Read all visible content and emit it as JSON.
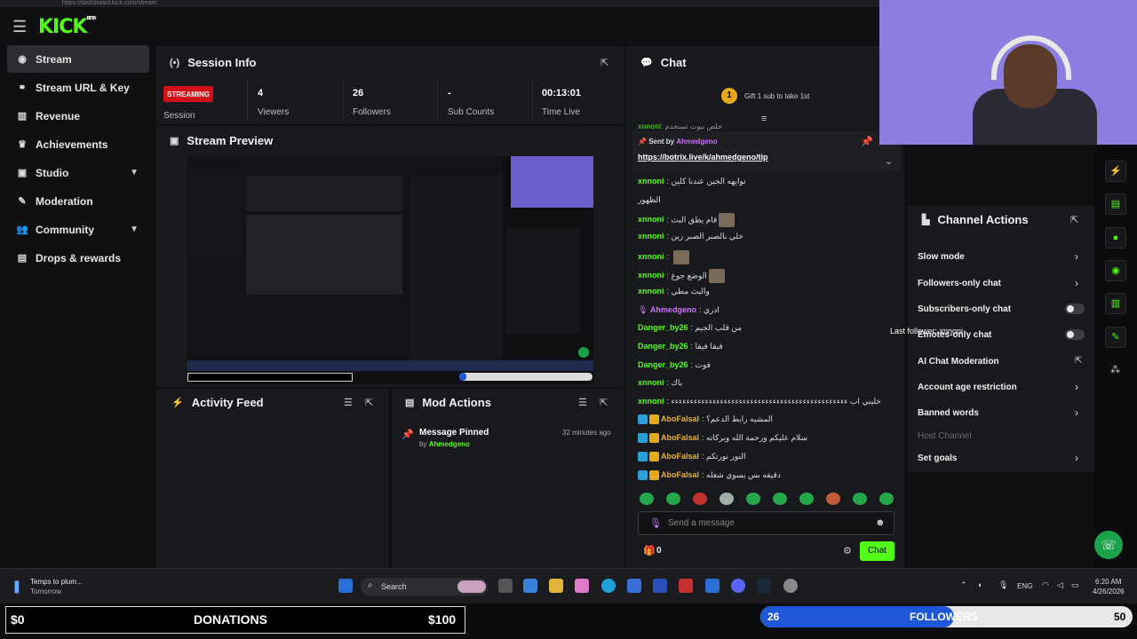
{
  "browser": {
    "url": "https://dashboard.kick.com/stream"
  },
  "app": {
    "logo": "KICK",
    "logo_sup": "BETA",
    "accent": "#53fc18"
  },
  "sidebar": {
    "items": [
      {
        "label": "Stream",
        "icon": "broadcast-icon"
      },
      {
        "label": "Stream URL & Key",
        "icon": "link-icon"
      },
      {
        "label": "Revenue",
        "icon": "chart-icon"
      },
      {
        "label": "Achievements",
        "icon": "trophy-icon"
      },
      {
        "label": "Studio",
        "icon": "tv-icon"
      },
      {
        "label": "Moderation",
        "icon": "wrench-icon"
      },
      {
        "label": "Community",
        "icon": "users-icon"
      },
      {
        "label": "Drops & rewards",
        "icon": "gift-icon"
      }
    ]
  },
  "session": {
    "title": "Session Info",
    "status": "STREAMING",
    "status_label": "Session",
    "stats": [
      {
        "value": "4",
        "label": "Viewers"
      },
      {
        "value": "26",
        "label": "Followers"
      },
      {
        "value": "-",
        "label": "Sub Counts"
      },
      {
        "value": "00:13:01",
        "label": "Time Live"
      }
    ]
  },
  "preview": {
    "title": "Stream Preview"
  },
  "activity": {
    "title": "Activity Feed"
  },
  "mod_actions": {
    "title": "Mod Actions",
    "item_title": "Message Pinned",
    "item_by": "by",
    "item_user": "Ahmedgeno",
    "item_time": "32 minutes ago"
  },
  "chat": {
    "title": "Chat",
    "gift_number": "1",
    "gift_text": "Gift 1 sub to take 1st",
    "pinned_sent_by": "Sent by",
    "pinned_user": "Ahmedgeno",
    "pinned_link": "https://botrix.live/k/ahmedgeno/tip",
    "partial_top": "خلص ببوت تستخدم",
    "messages": [
      {
        "user": "xnnoni",
        "text": "نوايهه الجين عندنا كلين",
        "color": "g"
      },
      {
        "user": "",
        "text": "الظهور",
        "color": "g"
      },
      {
        "user": "xnnoni",
        "text": "قام يطق البث",
        "color": "g"
      },
      {
        "user": "xnnoni",
        "text": "خلي بالصبر الصبر زين",
        "color": "g"
      },
      {
        "user": "xnnoni",
        "text": "",
        "color": "g"
      },
      {
        "user": "xnnoni",
        "text": "الوضع جوع",
        "color": "g"
      },
      {
        "user": "xnnoni",
        "text": "والبث مطي",
        "color": "g"
      },
      {
        "user": "Ahmedgeno",
        "text": "ادري",
        "color": "p"
      },
      {
        "user": "Danger_by26",
        "text": "من قلب الجيم",
        "color": "g"
      },
      {
        "user": "Danger_by26",
        "text": "فيقا فيقا",
        "color": "g"
      },
      {
        "user": "Danger_by26",
        "text": "فوت",
        "color": "g"
      },
      {
        "user": "xnnoni",
        "text": "باك",
        "color": "g"
      },
      {
        "user": "xnnoni",
        "text": "خليني اب ءءءءءءءءءءءءءءءءءءءءءءءءءءءءءءءءءءءءءءءءءءءءءءء",
        "color": "g"
      },
      {
        "user": "AboFalsal",
        "text": "المشيه رابط الدعم؟",
        "color": "y"
      },
      {
        "user": "AboFalsal",
        "text": "سلام عليكم ورحمة الله وبركاته",
        "color": "y"
      },
      {
        "user": "AboFalsal",
        "text": "النور نورتكم",
        "color": "y"
      },
      {
        "user": "AboFalsal",
        "text": "دقيقه بس بسوي شغله",
        "color": "y"
      }
    ],
    "input_placeholder": "Send a message",
    "points": "0",
    "send_label": "Chat"
  },
  "channel_actions": {
    "title": "Channel Actions",
    "items": [
      {
        "label": "Slow mode",
        "control": "chevron"
      },
      {
        "label": "Followers-only chat",
        "control": "chevron"
      },
      {
        "label": "Subscribers-only chat",
        "control": "toggle"
      },
      {
        "label": "Emotes-only chat",
        "control": "toggle"
      },
      {
        "label": "AI Chat Moderation",
        "control": "external"
      },
      {
        "label": "Account age restriction",
        "control": "chevron"
      },
      {
        "label": "Banned words",
        "control": "chevron"
      },
      {
        "label": "Host Channel",
        "control": "none"
      },
      {
        "label": "Set goals",
        "control": "chevron"
      }
    ]
  },
  "overlay": {
    "last_follower": "Last follower: xnnoni"
  },
  "taskbar": {
    "weather_title": "Temps to plum...",
    "weather_sub": "Tomorrow",
    "search": "Search",
    "lang": "ENG",
    "time": "6:20 AM",
    "date": "4/26/2026"
  },
  "donations": {
    "start": "$0",
    "label": "DONATIONS",
    "goal": "$100",
    "progress": 0
  },
  "followers_goal": {
    "current": "26",
    "label": "FOLLOWERS",
    "goal": "50",
    "progress": 0.52
  }
}
